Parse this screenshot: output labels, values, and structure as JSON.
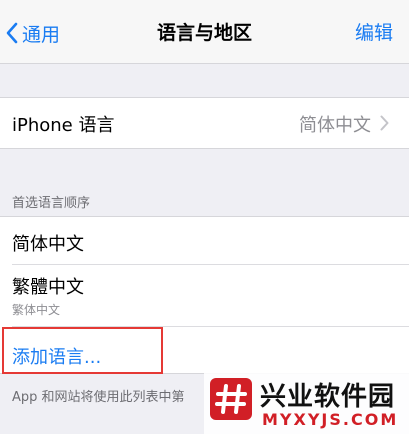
{
  "nav": {
    "back_label": "通用",
    "title": "语言与地区",
    "edit_label": "编辑"
  },
  "iphone_language": {
    "label": "iPhone 语言",
    "value": "简体中文"
  },
  "preferred_languages": {
    "header": "首选语言顺序",
    "items": [
      {
        "label": "简体中文",
        "sublabel": ""
      },
      {
        "label": "繁體中文",
        "sublabel": "繁体中文"
      }
    ],
    "add_label": "添加语言..."
  },
  "footer_text": "App 和网站将使用此列表中第",
  "watermark": {
    "name": "兴业软件园",
    "url": "MYXYJS.COM"
  },
  "colors": {
    "accent": "#1a7cf2",
    "highlight": "#e53935",
    "watermark_red": "#d11f26"
  }
}
